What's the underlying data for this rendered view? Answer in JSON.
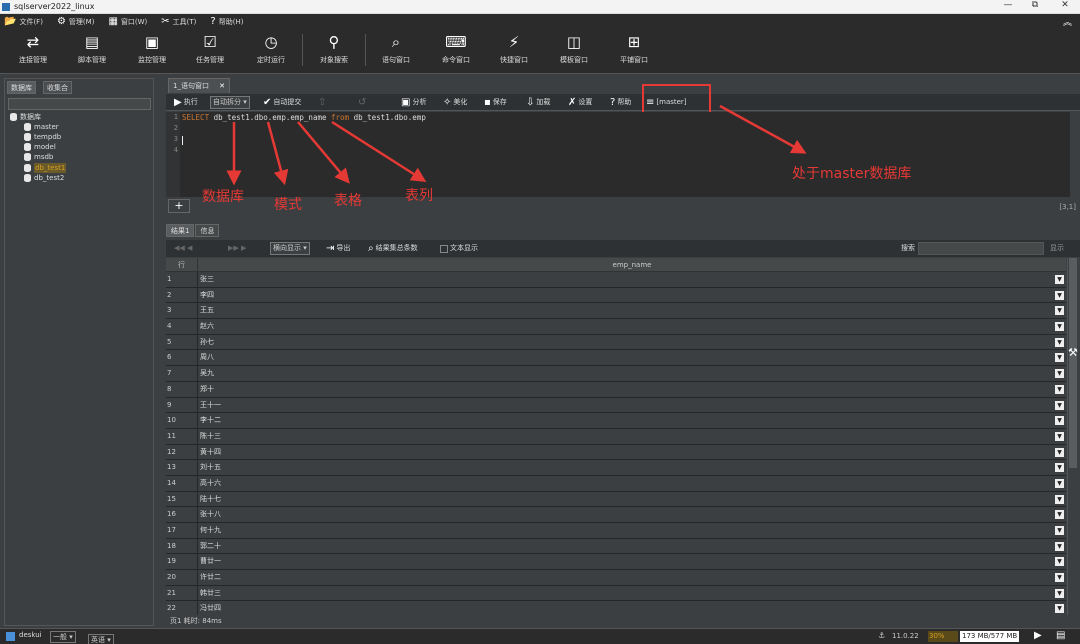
{
  "window": {
    "title": "sqlserver2022_linux",
    "controls": [
      "—",
      "⧉",
      "✕"
    ]
  },
  "menu": [
    {
      "icon": "folder-icon",
      "glyph": "📂",
      "label": "文件(F)"
    },
    {
      "icon": "gear-icon",
      "glyph": "⚙",
      "label": "管理(M)"
    },
    {
      "icon": "window-icon",
      "glyph": "▦",
      "label": "窗口(W)"
    },
    {
      "icon": "tools-icon",
      "glyph": "✂",
      "label": "工具(T)"
    },
    {
      "icon": "help-icon",
      "glyph": "?",
      "label": "帮助(H)"
    }
  ],
  "ribbon": [
    {
      "icon": "connection-icon",
      "glyph": "⇄",
      "label": "连接管理"
    },
    {
      "icon": "script-icon",
      "glyph": "▤",
      "label": "脚本管理"
    },
    {
      "icon": "monitor-icon",
      "glyph": "▣",
      "label": "监控管理"
    },
    {
      "icon": "task-icon",
      "glyph": "☑",
      "label": "任务管理"
    },
    {
      "icon": "clock-icon",
      "glyph": "◷",
      "label": "定时运行"
    },
    {
      "icon": "object-search-icon",
      "glyph": "⚲",
      "label": "对象搜索"
    },
    {
      "icon": "search-icon",
      "glyph": "⌕",
      "label": "语句窗口"
    },
    {
      "icon": "command-icon",
      "glyph": "⌨",
      "label": "命令窗口"
    },
    {
      "icon": "bolt-icon",
      "glyph": "⚡",
      "label": "快捷窗口"
    },
    {
      "icon": "template-icon",
      "glyph": "◫",
      "label": "模板窗口"
    },
    {
      "icon": "grid-icon",
      "glyph": "⊞",
      "label": "平铺窗口"
    }
  ],
  "left_panel": {
    "tabs": [
      "数据库",
      "收集合"
    ],
    "root": "数据库",
    "databases": [
      "master",
      "tempdb",
      "model",
      "msdb",
      "db_test1",
      "db_test2"
    ],
    "selected": "db_test1"
  },
  "editor_tab": "1_语句窗口",
  "query_toolbar": {
    "run": "执行",
    "mode": "自动拆分",
    "autocommit": "自动提交",
    "analyze": "分析",
    "beautify": "美化",
    "save": "保存",
    "load": "加载",
    "settings": "设置",
    "help": "帮助",
    "db_indicator": "[master]"
  },
  "editor": {
    "line_numbers": [
      "1",
      "2",
      "3",
      "4"
    ],
    "kw_select": "SELECT",
    "sql_mid": " db_test1.dbo.emp.emp_name ",
    "kw_from": "from",
    "sql_end": " db_test1.dbo.emp",
    "cursor": "[3,1]"
  },
  "results": {
    "tabs": [
      "结果1",
      "信息"
    ],
    "toolbar": {
      "view": "横向显示",
      "export": "导出",
      "count": "结果集总条数",
      "text": "文本显示",
      "search": "搜索",
      "show": "显示"
    },
    "header_rownum": "行",
    "column": "emp_name",
    "rows": [
      "张三",
      "李四",
      "王五",
      "赵六",
      "孙七",
      "周八",
      "吴九",
      "郑十",
      "王十一",
      "李十二",
      "陈十三",
      "黄十四",
      "刘十五",
      "高十六",
      "陆十七",
      "张十八",
      "何十九",
      "郭二十",
      "曹廿一",
      "许廿二",
      "韩廿三",
      "冯廿四"
    ],
    "footer": "页1    耗时: 84ms"
  },
  "status": {
    "user": "deskui",
    "level": "一般",
    "lang": "英语",
    "version": "11.0.22",
    "progress": "30%",
    "memory": "173 MB/577 MB"
  },
  "annotations": {
    "database": "数据库",
    "schema": "模式",
    "table": "表格",
    "column": "表列",
    "context": "处于master数据库"
  },
  "colors": {
    "accent": "#e53935",
    "selected_bg": "#6b5a2a",
    "keyword": "#cc7832"
  }
}
